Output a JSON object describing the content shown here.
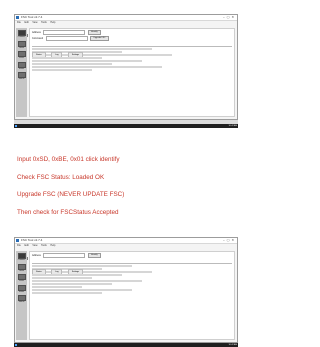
{
  "screenshot": {
    "window_title": "FSC Tool v2.7.4",
    "menu": [
      "File",
      "Edit",
      "View",
      "Tools",
      "Help"
    ],
    "address_label": "Address",
    "command_label": "Command",
    "identify_button": "Identify",
    "upgrade_button": "Upgrade FSC",
    "tabs": [
      "Status",
      "Log",
      "Settings"
    ],
    "sidebar": [
      "Connect",
      "Read",
      "Write",
      "Reset",
      "Status"
    ],
    "clock": "10:42 AM"
  },
  "instructions": {
    "step1": "Input 0xSD, 0xBE, 0x01 click identify",
    "step2": "Check FSC Status: Loaded OK",
    "step3": "Upgrade FSC (NEVER UPDATE FSC)",
    "step4": "Then check for FSCStatus Accepted"
  },
  "colors": {
    "accent_text": "#c8372a",
    "taskbar": "#1f1f1f"
  }
}
